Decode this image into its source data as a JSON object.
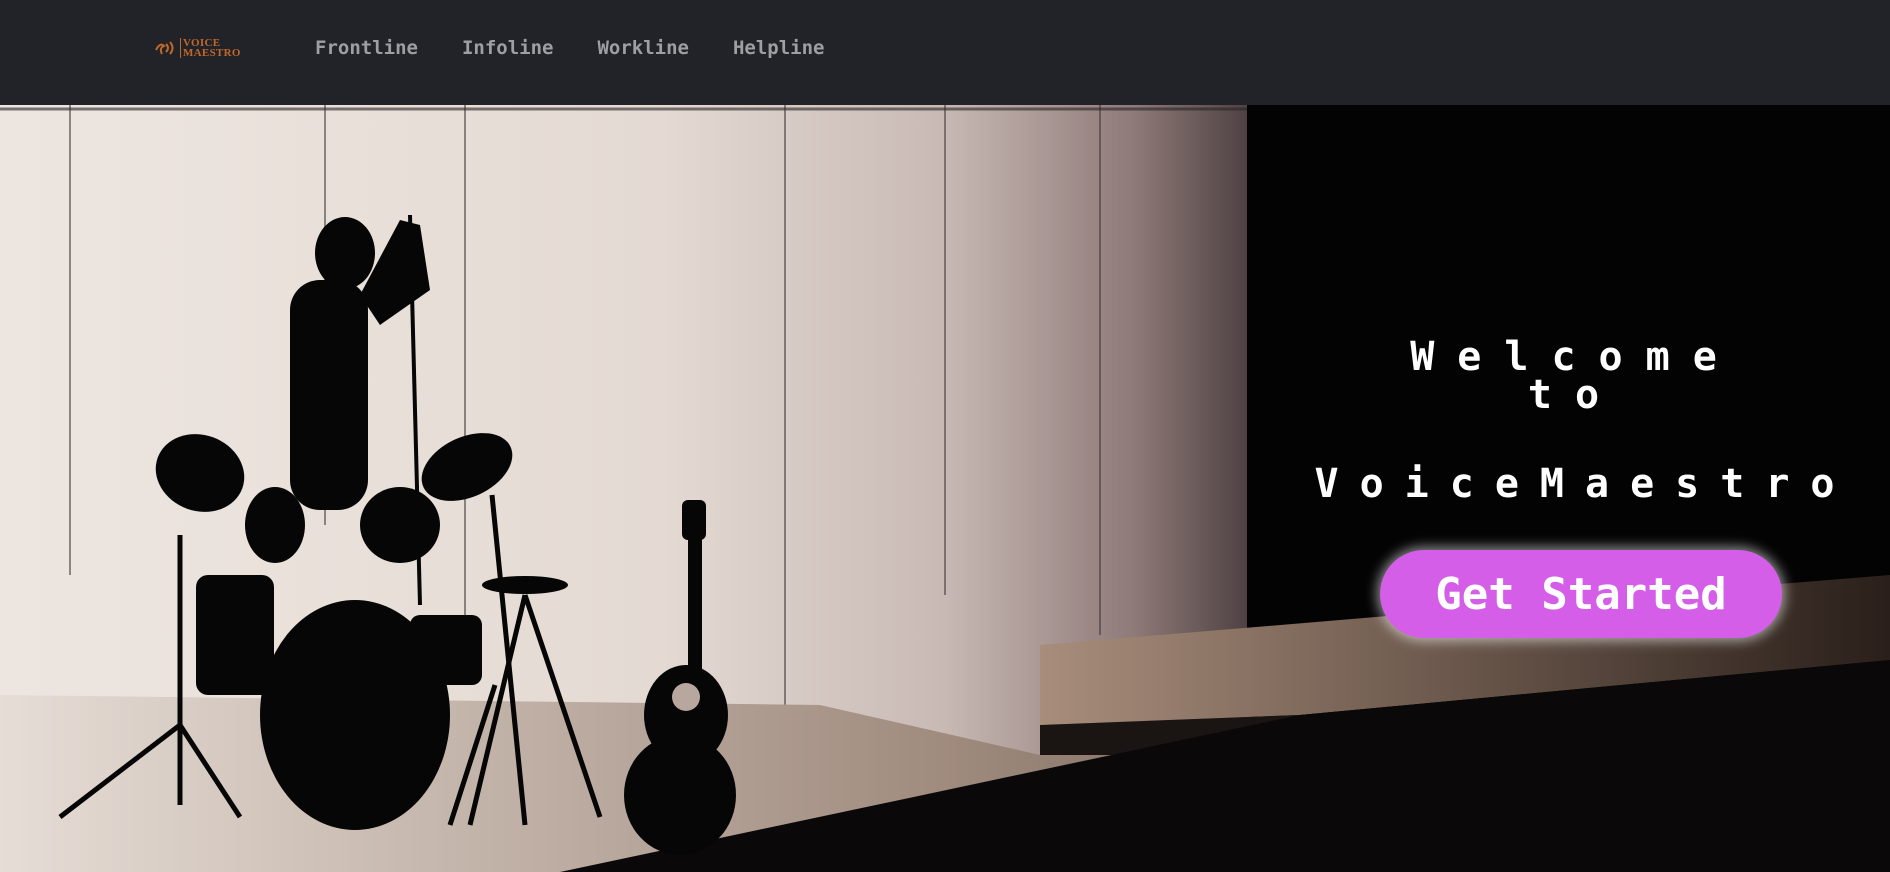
{
  "brand": {
    "line1": "VOICE",
    "line2": "MAESTRO",
    "logo_icon": "microphone-wave-icon",
    "color": "#c0682a"
  },
  "nav": {
    "items": [
      {
        "label": "Frontline"
      },
      {
        "label": "Infoline"
      },
      {
        "label": "Workline"
      },
      {
        "label": "Helpline"
      }
    ]
  },
  "hero": {
    "welcome_line1": "Welcome",
    "welcome_line2": "to",
    "title": "VoiceMaestro",
    "cta_label": "Get Started",
    "cta_color": "#d45ee8"
  }
}
